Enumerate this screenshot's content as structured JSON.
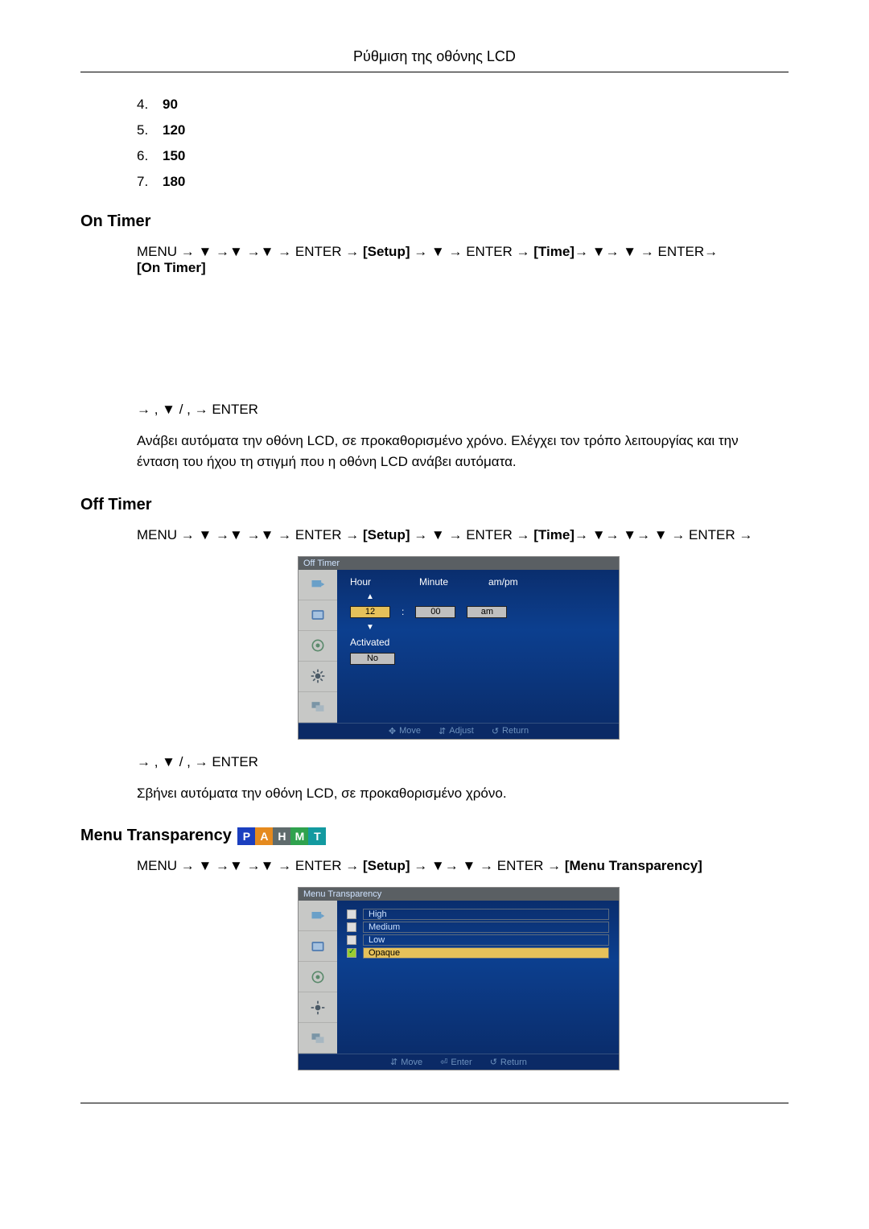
{
  "header": {
    "title": "Ρύθμιση της οθόνης LCD"
  },
  "list": {
    "items": [
      {
        "n": "4.",
        "v": "90"
      },
      {
        "n": "5.",
        "v": "120"
      },
      {
        "n": "6.",
        "v": "150"
      },
      {
        "n": "7.",
        "v": "180"
      }
    ]
  },
  "on_timer": {
    "heading": "On Timer",
    "path_pre": "MENU → ▼ →▼ →▼ → ENTER → ",
    "path_setup": "[Setup]",
    "path_mid": " → ▼ → ENTER → ",
    "path_time": "[Time]",
    "path_post": "→ ▼→ ▼ → ENTER→ ",
    "path_end": "[On Timer]",
    "nav2": "→   , ▼ /   ,   → ENTER",
    "desc": "Ανάβει αυτόματα την οθόνη LCD, σε προκαθορισμένο χρόνο. Ελέγχει τον τρόπο λειτουργίας και την ένταση του ήχου τη στιγμή που η οθόνη LCD ανάβει αυτόματα."
  },
  "off_timer": {
    "heading": "Off Timer",
    "path_pre": "MENU → ▼ →▼ →▼ → ENTER → ",
    "path_setup": "[Setup]",
    "path_mid": " → ▼ → ENTER → ",
    "path_time": "[Time]",
    "path_post": "→ ▼→ ▼→ ▼ → ENTER →",
    "nav2": "→   , ▼ /   ,   → ENTER",
    "desc": "Σβήνει αυτόματα την οθόνη LCD, σε προκαθορισμένο χρόνο.",
    "osd": {
      "title": "Off Timer",
      "labels": {
        "hour": "Hour",
        "minute": "Minute",
        "ampm": "am/pm"
      },
      "values": {
        "hour": "12",
        "minute": "00",
        "ampm": "am",
        "colon": ":"
      },
      "activated": "Activated",
      "activated_value": "No",
      "footer": {
        "move": "Move",
        "adjust": "Adjust",
        "ret": "Return"
      }
    }
  },
  "menu_transparency": {
    "heading": "Menu Transparency",
    "pahmt": {
      "p": "P",
      "a": "A",
      "h": "H",
      "m": "M",
      "t": "T"
    },
    "path_pre": "MENU → ▼ →▼ →▼ → ENTER → ",
    "path_setup": "[Setup]",
    "path_mid": " → ▼→ ▼ → ENTER → ",
    "path_end": "[Menu Transparency]",
    "osd": {
      "title": "Menu Transparency",
      "options": {
        "high": "High",
        "medium": "Medium",
        "low": "Low",
        "opaque": "Opaque"
      },
      "footer": {
        "move": "Move",
        "enter": "Enter",
        "ret": "Return"
      }
    }
  }
}
